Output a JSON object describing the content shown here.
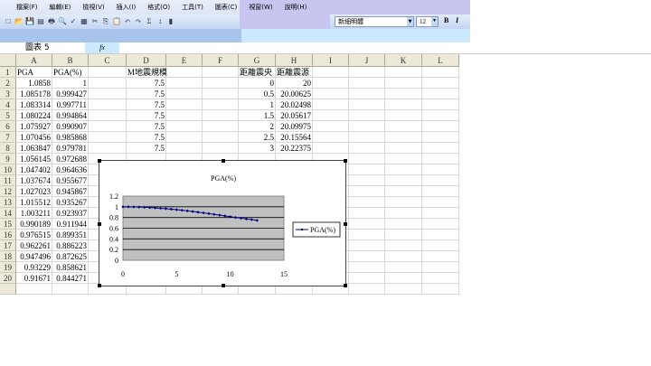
{
  "menu": [
    "檔案(F)",
    "編輯(E)",
    "檢視(V)",
    "插入(I)",
    "格式(O)",
    "工具(T)",
    "圖表(C)",
    "視窗(W)",
    "說明(H)"
  ],
  "toolbar": {
    "font": "新細明體",
    "size": "12",
    "bold": "B",
    "italic": "I"
  },
  "formula": {
    "name_box": "圖表 5",
    "fx": "fx",
    "value": ""
  },
  "columns": [
    "A",
    "B",
    "C",
    "D",
    "E",
    "F",
    "G",
    "H",
    "I",
    "J",
    "K",
    "L"
  ],
  "rows": [
    {
      "n": "1",
      "A": "PGA",
      "B": "PGA(%)",
      "D": "M地震規模",
      "G": "距離震央",
      "H": "距離震源"
    },
    {
      "n": "2",
      "A": "1.0858",
      "B": "1",
      "D": "7.5",
      "G": "0",
      "H": "20"
    },
    {
      "n": "3",
      "A": "1.085178",
      "B": "0.999427",
      "D": "7.5",
      "G": "0.5",
      "H": "20.00625"
    },
    {
      "n": "4",
      "A": "1.083314",
      "B": "0.997711",
      "D": "7.5",
      "G": "1",
      "H": "20.02498"
    },
    {
      "n": "5",
      "A": "1.080224",
      "B": "0.994864",
      "D": "7.5",
      "G": "1.5",
      "H": "20.05617"
    },
    {
      "n": "6",
      "A": "1.075927",
      "B": "0.990907",
      "D": "7.5",
      "G": "2",
      "H": "20.09975"
    },
    {
      "n": "7",
      "A": "1.070456",
      "B": "0.985868",
      "D": "7.5",
      "G": "2.5",
      "H": "20.15564"
    },
    {
      "n": "8",
      "A": "1.063847",
      "B": "0.979781",
      "D": "7.5",
      "G": "3",
      "H": "20.22375"
    },
    {
      "n": "9",
      "A": "1.056145",
      "B": "0.972688"
    },
    {
      "n": "10",
      "A": "1.047402",
      "B": "0.964636"
    },
    {
      "n": "11",
      "A": "1.037674",
      "B": "0.955677"
    },
    {
      "n": "12",
      "A": "1.027023",
      "B": "0.945867"
    },
    {
      "n": "13",
      "A": "1.015512",
      "B": "0.935267"
    },
    {
      "n": "14",
      "A": "1.003211",
      "B": "0.923937"
    },
    {
      "n": "15",
      "A": "0.990189",
      "B": "0.911944"
    },
    {
      "n": "16",
      "A": "0.976515",
      "B": "0.899351"
    },
    {
      "n": "17",
      "A": "0.962261",
      "B": "0.886223"
    },
    {
      "n": "18",
      "A": "0.947496",
      "B": "0.872625"
    },
    {
      "n": "19",
      "A": "0.93229",
      "B": "0.858621"
    },
    {
      "n": "20",
      "A": "0.91671",
      "B": "0.844271"
    }
  ],
  "chart_data": {
    "type": "line",
    "title": "PGA(%)",
    "legend": "PGA(%)",
    "legend_position": "right",
    "x": [
      0,
      0.5,
      1,
      1.5,
      2,
      2.5,
      3,
      3.5,
      4,
      4.5,
      5,
      5.5,
      6,
      6.5,
      7,
      7.5,
      8,
      8.5,
      9,
      9.5,
      10,
      10.5,
      11,
      11.5,
      12,
      12.5
    ],
    "y": [
      1,
      0.999427,
      0.997711,
      0.994864,
      0.990907,
      0.985868,
      0.979781,
      0.972688,
      0.964636,
      0.955677,
      0.945867,
      0.935267,
      0.923937,
      0.911944,
      0.899351,
      0.886223,
      0.872625,
      0.858621,
      0.844271,
      0.83,
      0.815,
      0.8,
      0.787,
      0.773,
      0.76,
      0.745
    ],
    "xlim": [
      0,
      15
    ],
    "ylim": [
      0,
      1.2
    ],
    "xticks": [
      "0",
      "5",
      "10",
      "15"
    ],
    "yticks": [
      "0",
      "0.2",
      "0.4",
      "0.6",
      "0.8",
      "1",
      "1.2"
    ],
    "plot_bg": "#c0c0c0",
    "line_color": "#000080"
  }
}
